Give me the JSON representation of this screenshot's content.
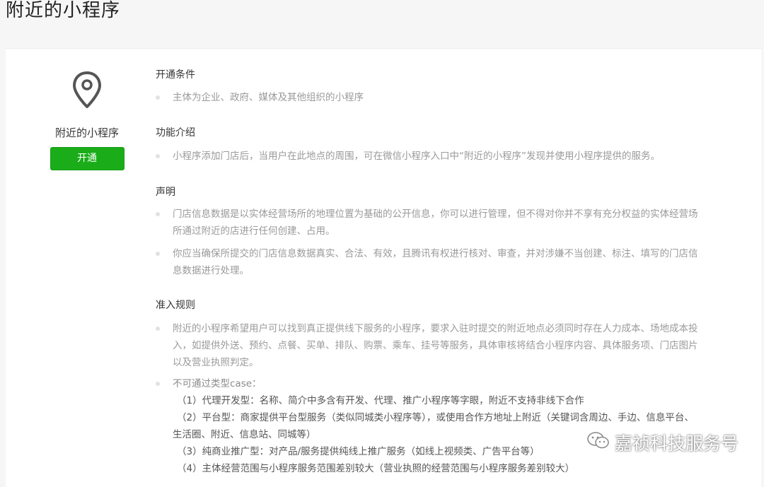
{
  "header": {
    "title": "附近的小程序"
  },
  "sidebar": {
    "title": "附近的小程序",
    "open_label": "开通",
    "icon": "location-pin-icon"
  },
  "sections": {
    "conditions": {
      "title": "开通条件",
      "items": [
        "主体为企业、政府、媒体及其他组织的小程序"
      ]
    },
    "features": {
      "title": "功能介绍",
      "items": [
        "小程序添加门店后，当用户在此地点的周围，可在微信小程序入口中“附近的小程序”发现并使用小程序提供的服务。"
      ]
    },
    "statement": {
      "title": "声明",
      "items": [
        [
          "门店信息数据是以实体经营场所的地理位置为基础的公开信息，你可以进行管理，但不得对你并不享有充分权益的实体经营场",
          "所通过附近的店进行任何创建、占用。"
        ],
        [
          "你应当确保所提交的门店信息数据真实、合法、有效，且腾讯有权进行核对、审查，并对涉嫌不当创建、标注、填写的门店信",
          "息数据进行处理。"
        ]
      ]
    },
    "rules": {
      "title": "准入规则",
      "items": [
        [
          "附近的小程序希望用户可以找到真正提供线下服务的小程序，要求入驻时提交的附近地点必须同时存在人力成本、场地成本投",
          "入，如提供外送、预约、点餐、买单、排队、购票、乘车、挂号等服务，具体审核将结合小程序内容、具体服务项、门店图片",
          "以及营业执照判定。"
        ]
      ],
      "case_title": "不可通过类型case：",
      "case_lines": [
        "（1）代理开发型：名称、简介中多含有开发、代理、推广小程序等字眼，附近不支持非线下合作",
        "（2）平台型：商家提供平台型服务（类似同城类小程序等），或使用合作方地址上附近（关键词含周边、手边、信息平台、",
        "生活圈、附近、信息站、同城等）",
        "（3）纯商业推广型：对产品/服务提供纯线上推广服务（如线上视频类、广告平台等）",
        "（4）主体经营范围与小程序服务范围差别较大（营业执照的经营范围与小程序服务差别较大）"
      ]
    }
  },
  "watermark": {
    "text": "嘉祯科技服务号",
    "icon": "wechat-icon"
  },
  "colors": {
    "accent": "#1aad19",
    "muted_text": "#9a9a9a",
    "background": "#f6f6f6"
  }
}
